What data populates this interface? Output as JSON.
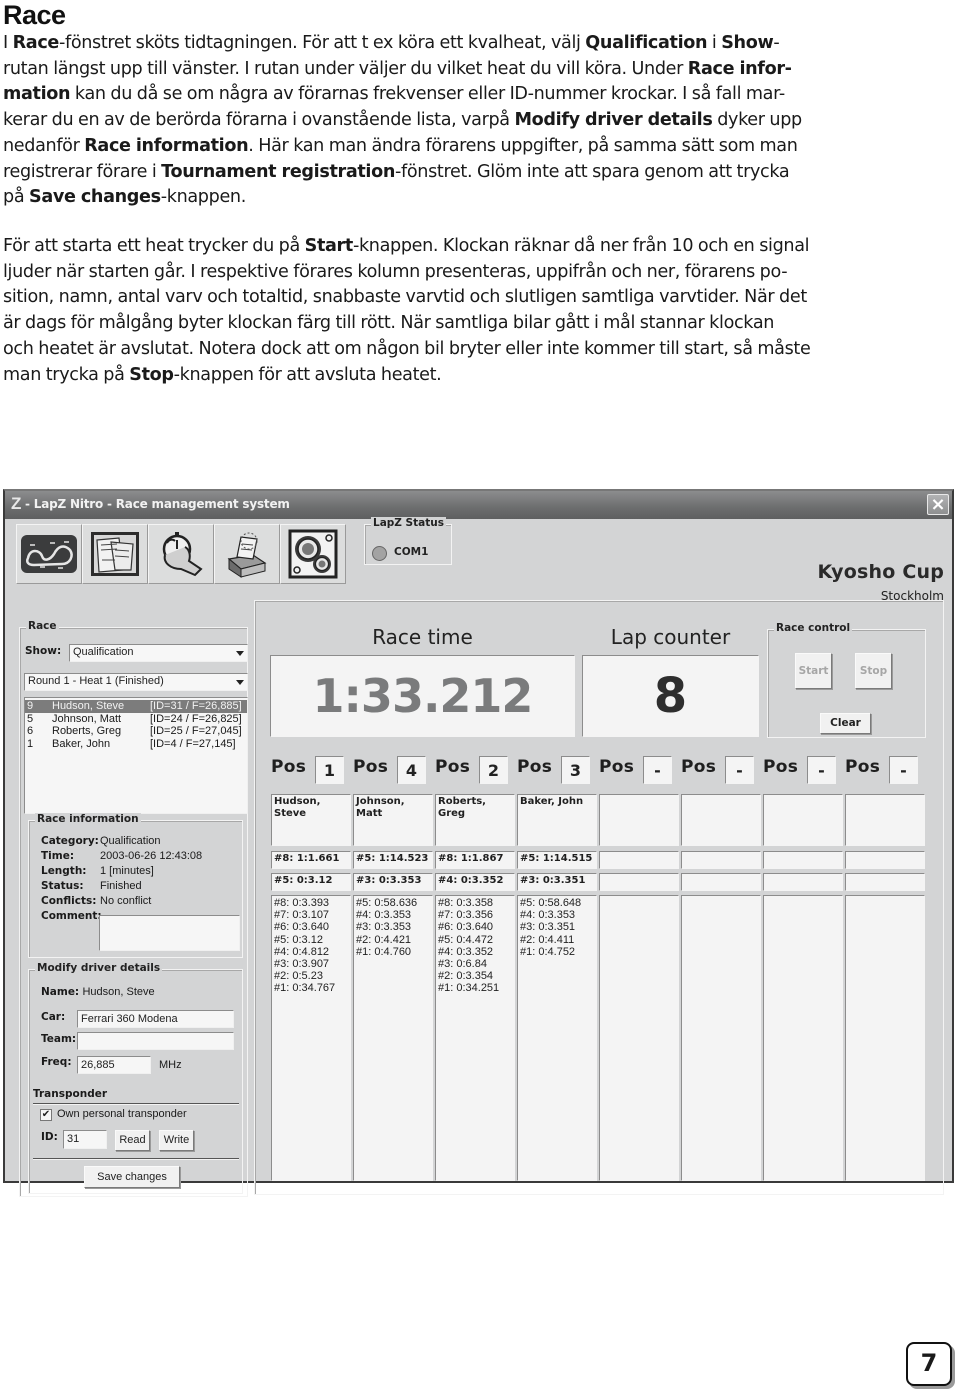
{
  "document": {
    "title": "Race",
    "paragraph1_lines": [
      [
        {
          "t": " I "
        },
        {
          "b": "Race"
        },
        {
          "t": "-fönstret sköts tidtagningen. För att t ex köra ett kvalheat, välj "
        },
        {
          "b": "Qualification"
        },
        {
          "t": " i "
        },
        {
          "b": "Show"
        },
        {
          "t": "-"
        }
      ],
      [
        {
          "t": "rutan längst upp till vänster. I rutan under väljer du vilket heat du vill köra. Under "
        },
        {
          "b": "Race infor-"
        }
      ],
      [
        {
          "b": "mation"
        },
        {
          "t": " kan du då se om några av förarnas frekvenser eller ID-nummer krockar. I så fall mar-"
        }
      ],
      [
        {
          "t": "kerar du en av de berörda förarna i ovanstående lista, varpå "
        },
        {
          "b": "Modify driver details"
        },
        {
          "t": " dyker upp"
        }
      ],
      [
        {
          "t": "nedanför "
        },
        {
          "b": "Race information"
        },
        {
          "t": ". Här kan man ändra förarens uppgifter, på samma sätt som man"
        }
      ],
      [
        {
          "t": "registrerar förare i "
        },
        {
          "b": "Tournament registration"
        },
        {
          "t": "-fönstret. Glöm inte att spara genom att trycka"
        }
      ],
      [
        {
          "t": "på "
        },
        {
          "b": "Save changes"
        },
        {
          "t": "-knappen."
        }
      ]
    ],
    "paragraph2_lines": [
      [
        {
          "t": "För att starta ett heat trycker du på "
        },
        {
          "b": "Start"
        },
        {
          "t": "-knappen. Klockan räknar då ner från 10 och en signal"
        }
      ],
      [
        {
          "t": "ljuder när starten går. I respektive förares kolumn presenteras, uppifrån och ner, förarens po-"
        }
      ],
      [
        {
          "t": "sition, namn, antal varv och totaltid, snabbaste varvtid och slutligen samtliga varvtider. När det"
        }
      ],
      [
        {
          "t": "är dags för målgång byter klockan färg till rött. När samtliga bilar gått i mål stannar klockan"
        }
      ],
      [
        {
          "t": "och heatet är avslutat. Notera dock att om någon bil bryter eller inte kommer till start, så måste"
        }
      ],
      [
        {
          "t": "man trycka på "
        },
        {
          "b": "Stop"
        },
        {
          "t": "-knappen för att avsluta heatet."
        }
      ]
    ],
    "page_number": "7"
  },
  "window": {
    "logo": "Z",
    "title": " - LapZ Nitro - Race management system",
    "close_icon": "close-icon",
    "toolbar": [
      {
        "name": "track-map-button",
        "icon": "track-map-icon"
      },
      {
        "name": "registration-button",
        "icon": "documents-icon"
      },
      {
        "name": "race-timer-button",
        "icon": "stopwatch-hand-icon"
      },
      {
        "name": "results-button",
        "icon": "printer-icon"
      },
      {
        "name": "settings-button",
        "icon": "gears-icon"
      }
    ],
    "lapz_status": {
      "label": "LapZ Status",
      "port": "COM1"
    },
    "brand": {
      "title": "Kyosho Cup",
      "subtitle": "Stockholm"
    },
    "race": {
      "group_label": "Race",
      "show_label": "Show:",
      "show_value": "Qualification",
      "heat_value": "Round 1 - Heat 1 (Finished)",
      "drivers": [
        {
          "num": "9",
          "name": "Hudson, Steve",
          "id": "[ID=31 / F=26,885]",
          "selected": true
        },
        {
          "num": "5",
          "name": "Johnson, Matt",
          "id": "[ID=24 / F=26,825]",
          "selected": false
        },
        {
          "num": "6",
          "name": "Roberts, Greg",
          "id": "[ID=25 / F=27,045]",
          "selected": false
        },
        {
          "num": "1",
          "name": "Baker, John",
          "id": "[ID=4 / F=27,145]",
          "selected": false
        }
      ]
    },
    "race_information": {
      "group_label": "Race information",
      "rows": [
        {
          "key": "Category:",
          "value": "Qualification"
        },
        {
          "key": "Time:",
          "value": "2003-06-26 12:43:08"
        },
        {
          "key": "Length:",
          "value": "1 [minutes]"
        },
        {
          "key": "Status:",
          "value": "Finished"
        },
        {
          "key": "Conflicts:",
          "value": "No conflict"
        },
        {
          "key": "Comment:",
          "value": ""
        }
      ],
      "comment_value": ""
    },
    "modify_driver": {
      "group_label": "Modify driver details",
      "name_label": "Name:",
      "name_value": "Hudson, Steve",
      "car_label": "Car:",
      "car_value": "Ferrari 360 Modena",
      "team_label": "Team:",
      "team_value": "",
      "freq_label": "Freq:",
      "freq_value": "26,885",
      "freq_unit": "MHz",
      "transponder_label": "Transponder",
      "own_transponder_label": "Own personal transponder",
      "own_transponder_checked": true,
      "id_label": "ID:",
      "id_value": "31",
      "read_label": "Read",
      "write_label": "Write",
      "save_label": "Save changes"
    },
    "race_time": {
      "label": "Race time",
      "value": "1:33.212"
    },
    "lap_counter": {
      "label": "Lap counter",
      "value": "8"
    },
    "race_control": {
      "label": "Race control",
      "start_label": "Start",
      "stop_label": "Stop",
      "clear_label": "Clear",
      "start_enabled": false,
      "stop_enabled": false
    },
    "pos_label": "Pos",
    "columns": [
      {
        "pos": "1",
        "name": "Hudson,\nSteve",
        "total": "#8: 1:1.661",
        "best": "#5: 0:3.12",
        "laps": [
          "#8: 0:3.393",
          "#7: 0:3.107",
          "#6: 0:3.640",
          "#5: 0:3.12",
          "#4: 0:4.812",
          "#3: 0:3.907",
          "#2: 0:5.23",
          "#1: 0:34.767"
        ]
      },
      {
        "pos": "4",
        "name": "Johnson, Matt",
        "total": "#5: 1:14.523",
        "best": "#3: 0:3.353",
        "laps": [
          "#5: 0:58.636",
          "#4: 0:3.353",
          "#3: 0:3.353",
          "#2: 0:4.421",
          "#1: 0:4.760"
        ]
      },
      {
        "pos": "2",
        "name": "Roberts, Greg",
        "total": "#8: 1:1.867",
        "best": "#4: 0:3.352",
        "laps": [
          "#8: 0:3.358",
          "#7: 0:3.356",
          "#6: 0:3.640",
          "#5: 0:4.472",
          "#4: 0:3.352",
          "#3: 0:6.84",
          "#2: 0:3.354",
          "#1: 0:34.251"
        ]
      },
      {
        "pos": "3",
        "name": "Baker, John",
        "total": "#5: 1:14.515",
        "best": "#3: 0:3.351",
        "laps": [
          "#5: 0:58.648",
          "#4: 0:3.353",
          "#3: 0:3.351",
          "#2: 0:4.411",
          "#1: 0:4.752"
        ]
      },
      {
        "pos": "-",
        "name": "",
        "total": "",
        "best": "",
        "laps": []
      },
      {
        "pos": "-",
        "name": "",
        "total": "",
        "best": "",
        "laps": []
      },
      {
        "pos": "-",
        "name": "",
        "total": "",
        "best": "",
        "laps": []
      },
      {
        "pos": "-",
        "name": "",
        "total": "",
        "best": "",
        "laps": []
      }
    ]
  }
}
